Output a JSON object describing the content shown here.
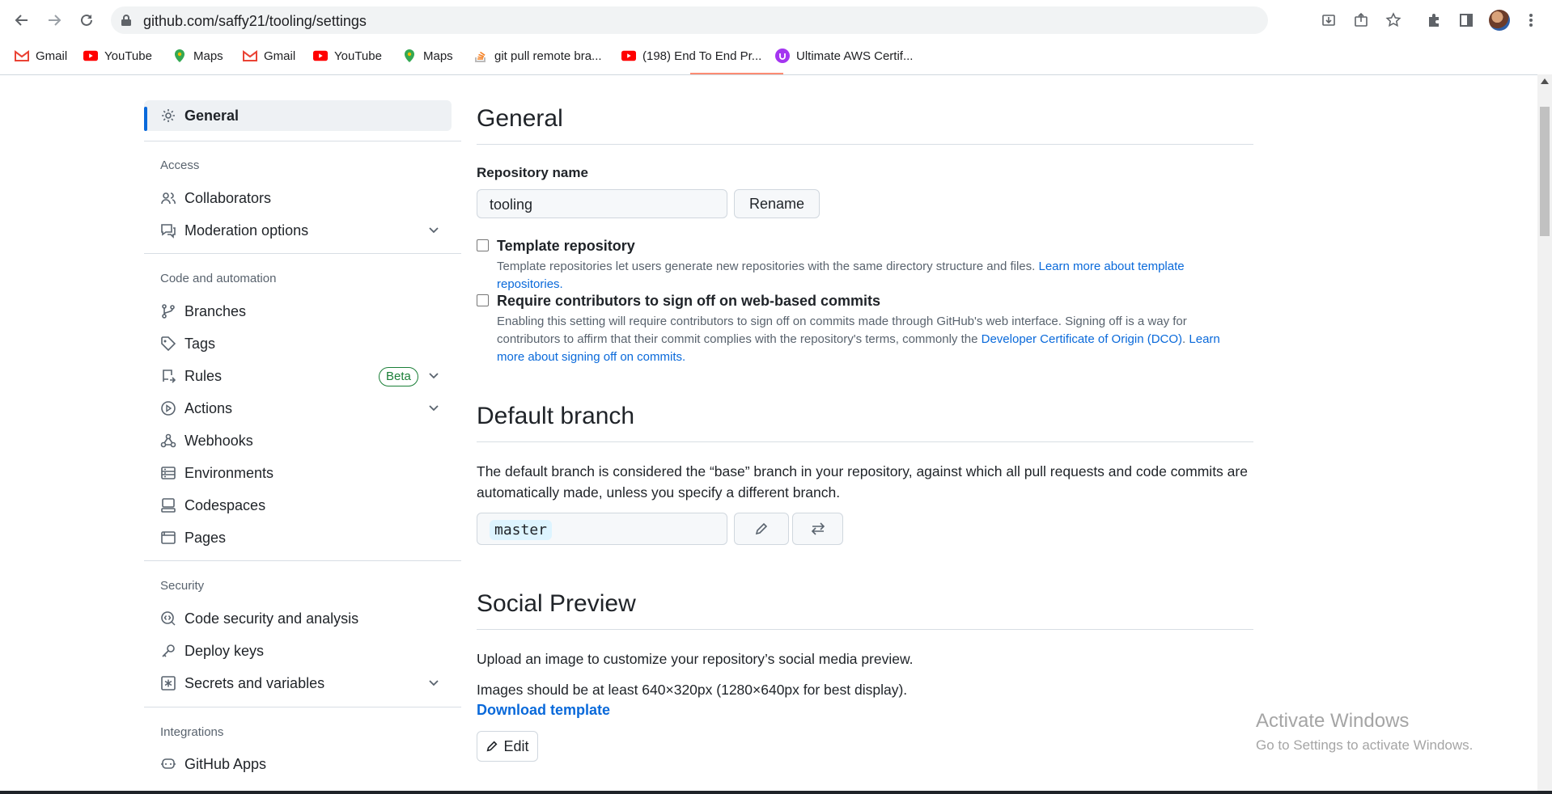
{
  "browser": {
    "url": "github.com/saffy21/tooling/settings",
    "bookmarks": [
      {
        "label": "Gmail",
        "icon": "gmail-icon"
      },
      {
        "label": "YouTube",
        "icon": "youtube-icon"
      },
      {
        "label": "Maps",
        "icon": "maps-icon"
      },
      {
        "label": "Gmail",
        "icon": "gmail-icon"
      },
      {
        "label": "YouTube",
        "icon": "youtube-icon"
      },
      {
        "label": "Maps",
        "icon": "maps-icon"
      },
      {
        "label": "git pull remote bra...",
        "icon": "stackoverflow-icon"
      },
      {
        "label": "(198) End To End Pr...",
        "icon": "youtube-icon"
      },
      {
        "label": "Ultimate AWS Certif...",
        "icon": "udemy-icon"
      }
    ]
  },
  "sidebar": {
    "general": "General",
    "sections": {
      "access": "Access",
      "code_automation": "Code and automation",
      "security": "Security",
      "integrations": "Integrations"
    },
    "items": {
      "collaborators": "Collaborators",
      "moderation": "Moderation options",
      "branches": "Branches",
      "tags": "Tags",
      "rules": "Rules",
      "rules_badge": "Beta",
      "actions": "Actions",
      "webhooks": "Webhooks",
      "environments": "Environments",
      "codespaces": "Codespaces",
      "pages": "Pages",
      "code_security": "Code security and analysis",
      "deploy_keys": "Deploy keys",
      "secrets": "Secrets and variables",
      "github_apps": "GitHub Apps"
    }
  },
  "general": {
    "title": "General",
    "repo_name_label": "Repository name",
    "repo_name_value": "tooling",
    "rename_button": "Rename",
    "template_label": "Template repository",
    "template_note": "Template repositories let users generate new repositories with the same directory structure and files. ",
    "template_link": "Learn more about template repositories.",
    "signoff_label": "Require contributors to sign off on web-based commits",
    "signoff_note": "Enabling this setting will require contributors to sign off on commits made through GitHub's web interface. Signing off is a way for contributors to affirm that their commit complies with the repository's terms, commonly the ",
    "signoff_link1": "Developer Certificate of Origin (DCO)",
    "signoff_link2": "Learn more about signing off on commits"
  },
  "default_branch": {
    "title": "Default branch",
    "description": "The default branch is considered the “base” branch in your repository, against which all pull requests and code commits are automatically made, unless you specify a different branch.",
    "branch": "master"
  },
  "social_preview": {
    "title": "Social Preview",
    "line1": "Upload an image to customize your repository’s social media preview.",
    "line2": "Images should be at least 640×320px (1280×640px for best display).",
    "download_link": "Download template",
    "edit_button": "Edit"
  },
  "watermark": {
    "line1": "Activate Windows",
    "line2": "Go to Settings to activate Windows."
  }
}
